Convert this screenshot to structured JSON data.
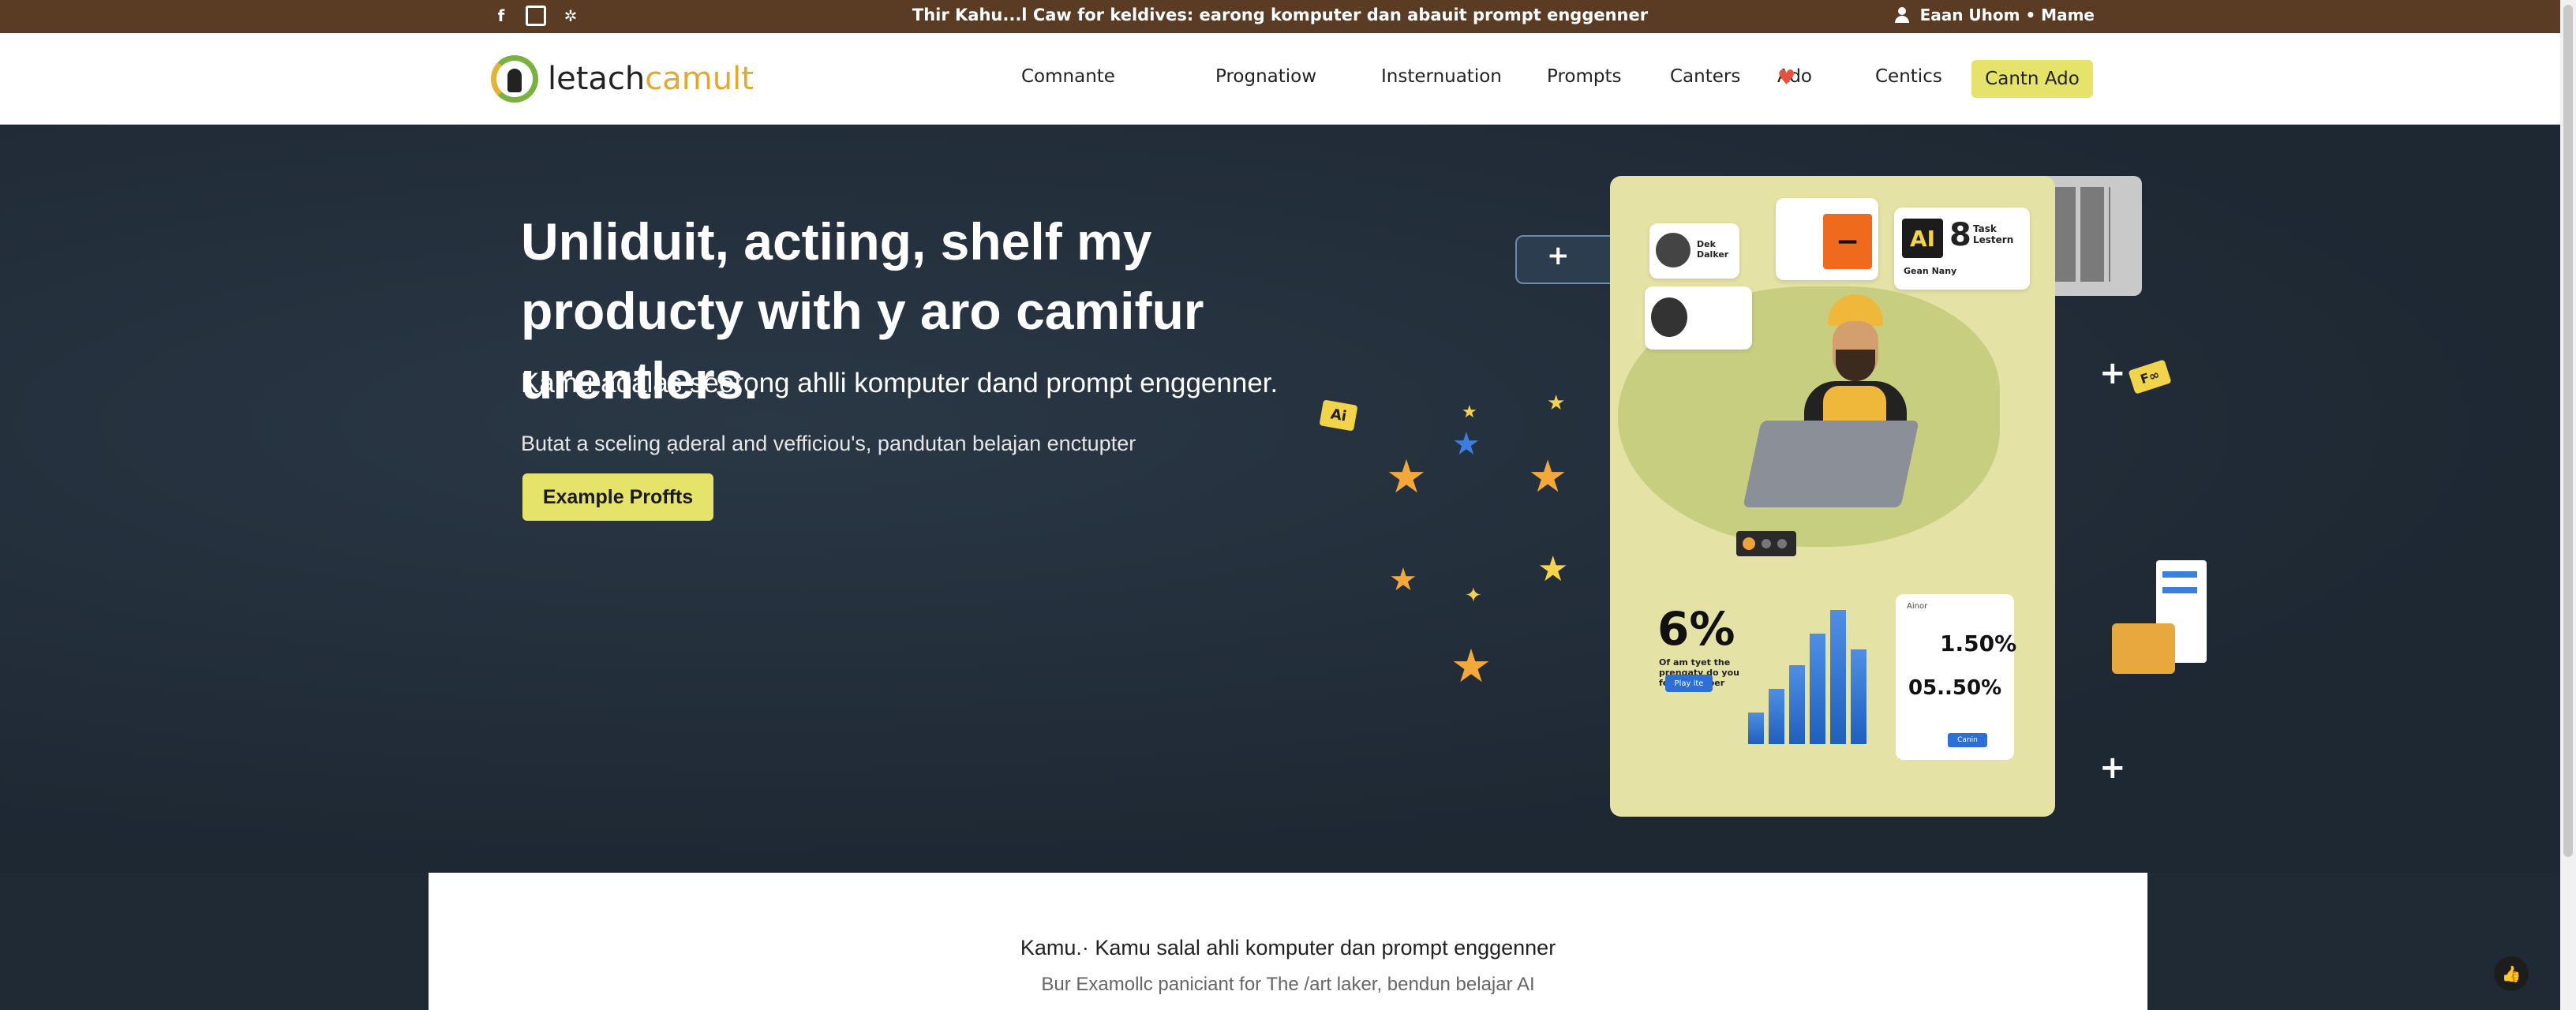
{
  "topbar": {
    "message": "Thir Kahu...l Caw for keldives: earong komputer dan abauit prompt enggenner",
    "user": "Eaan Uhom • Mame",
    "socials": [
      "facebook-icon",
      "instagram-icon",
      "settings-icon"
    ]
  },
  "nav": {
    "logo_main": "letach",
    "logo_accent": "camult",
    "items": [
      "Comnante",
      "Prognatiow",
      "Insternuation",
      "Prompts",
      "Canters",
      "Ado",
      "Centics"
    ],
    "cta": "Cantn Ado"
  },
  "hero": {
    "headline": "Unliduit, actiing, shelf my producty with y aro camifur urentlers.",
    "subtitle": "Kamu adalas seorong ahlli komputer dand prompt enggenner.",
    "description": "Butat a sceling ạderal and vefficiou's, pandutan belajan enctupter",
    "button": "Example Proffts"
  },
  "illustration": {
    "tag_ai": "Ai",
    "card_label_1": "Dek Dalker",
    "card_label_ai": "AI",
    "card_label_8": "8",
    "card_task": "Task Lestern",
    "card_dropdown": "Gean Nany",
    "stat_big": "6%",
    "stat_caption": "Of am tyet the prengaty do you feet oxember",
    "stat_button": "Play ite",
    "right_title": "Ainor",
    "right_value_1": "1.50%",
    "right_value_2": "05..50%",
    "right_button": "Canin",
    "tag_right": "F∞"
  },
  "bottom": {
    "title": "Kamu.· Kamu salal ahli komputer dan prompt enggenner",
    "subtitle": "Bur Examollc paniciant for The /art laker, bendun belajar AI"
  },
  "colors": {
    "topbar": "#5a3b24",
    "accent": "#e6e36a",
    "hero_bg": "#1f2a35",
    "heart": "#e5533d"
  }
}
